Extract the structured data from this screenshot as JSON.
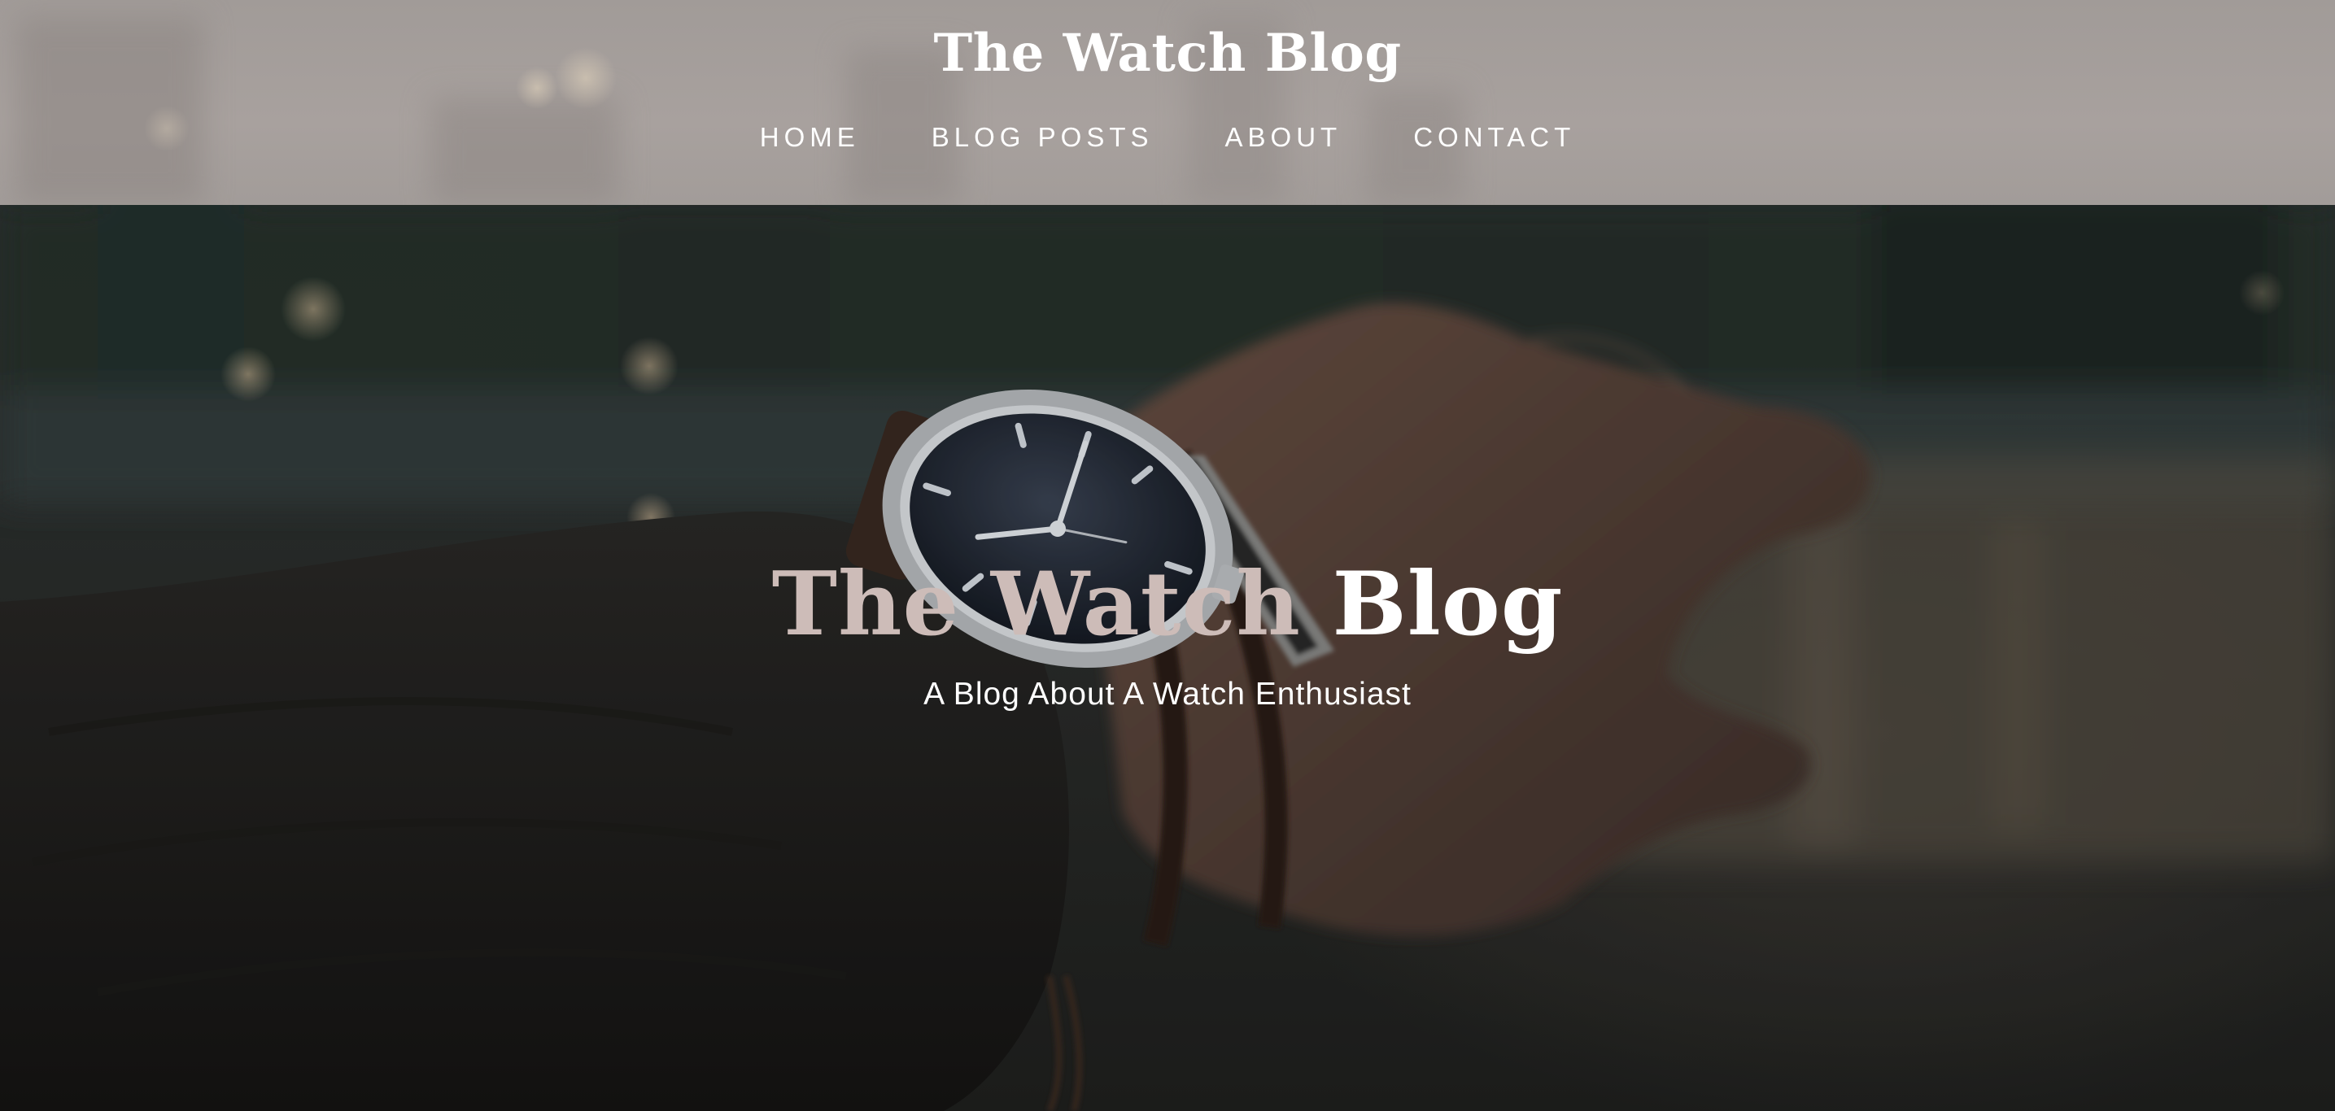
{
  "site": {
    "title": "The Watch Blog"
  },
  "nav": {
    "items": [
      {
        "label": "HOME"
      },
      {
        "label": "BLOG POSTS"
      },
      {
        "label": "ABOUT"
      },
      {
        "label": "CONTACT"
      }
    ]
  },
  "hero": {
    "title_part_a": "The Watch ",
    "title_part_b": "Blog",
    "subtitle": "A Blog About A Watch Enthusiast",
    "background_image": "wrist-watch-photo"
  },
  "colors": {
    "header_bg": "#a8a19e",
    "title_accent": "#cdbcb8",
    "text": "#ffffff"
  }
}
